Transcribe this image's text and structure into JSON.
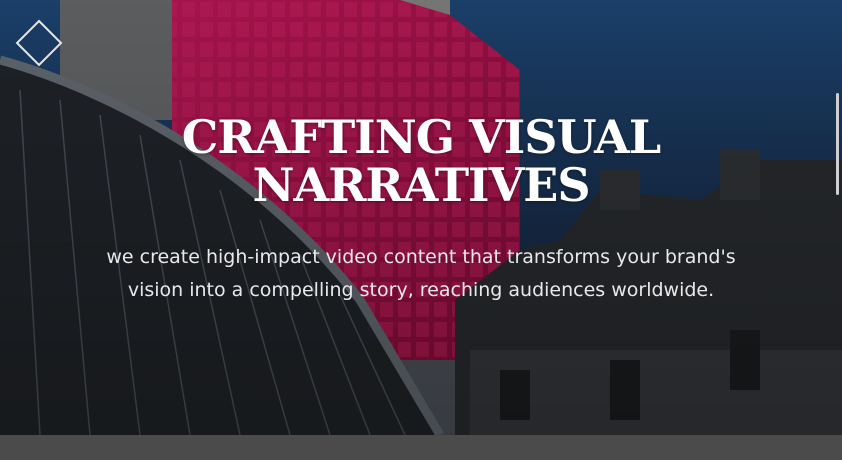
{
  "hero": {
    "headline_line1": "CRAFTING VISUAL",
    "headline_line2": "NARRATIVES",
    "subtitle": "we create high-impact video content that transforms your brand's vision into a compelling story, reaching audiences worldwide.",
    "background_image": "city-buildings-photo"
  },
  "logo": {
    "icon": "diamond-outline-icon"
  },
  "colors": {
    "headline": "#ffffff",
    "subtitle": "#e9e9ec",
    "magenta_facade": "#b8114f",
    "sky": "#1d3b63",
    "bottom_bar": "#4b4b4b"
  }
}
